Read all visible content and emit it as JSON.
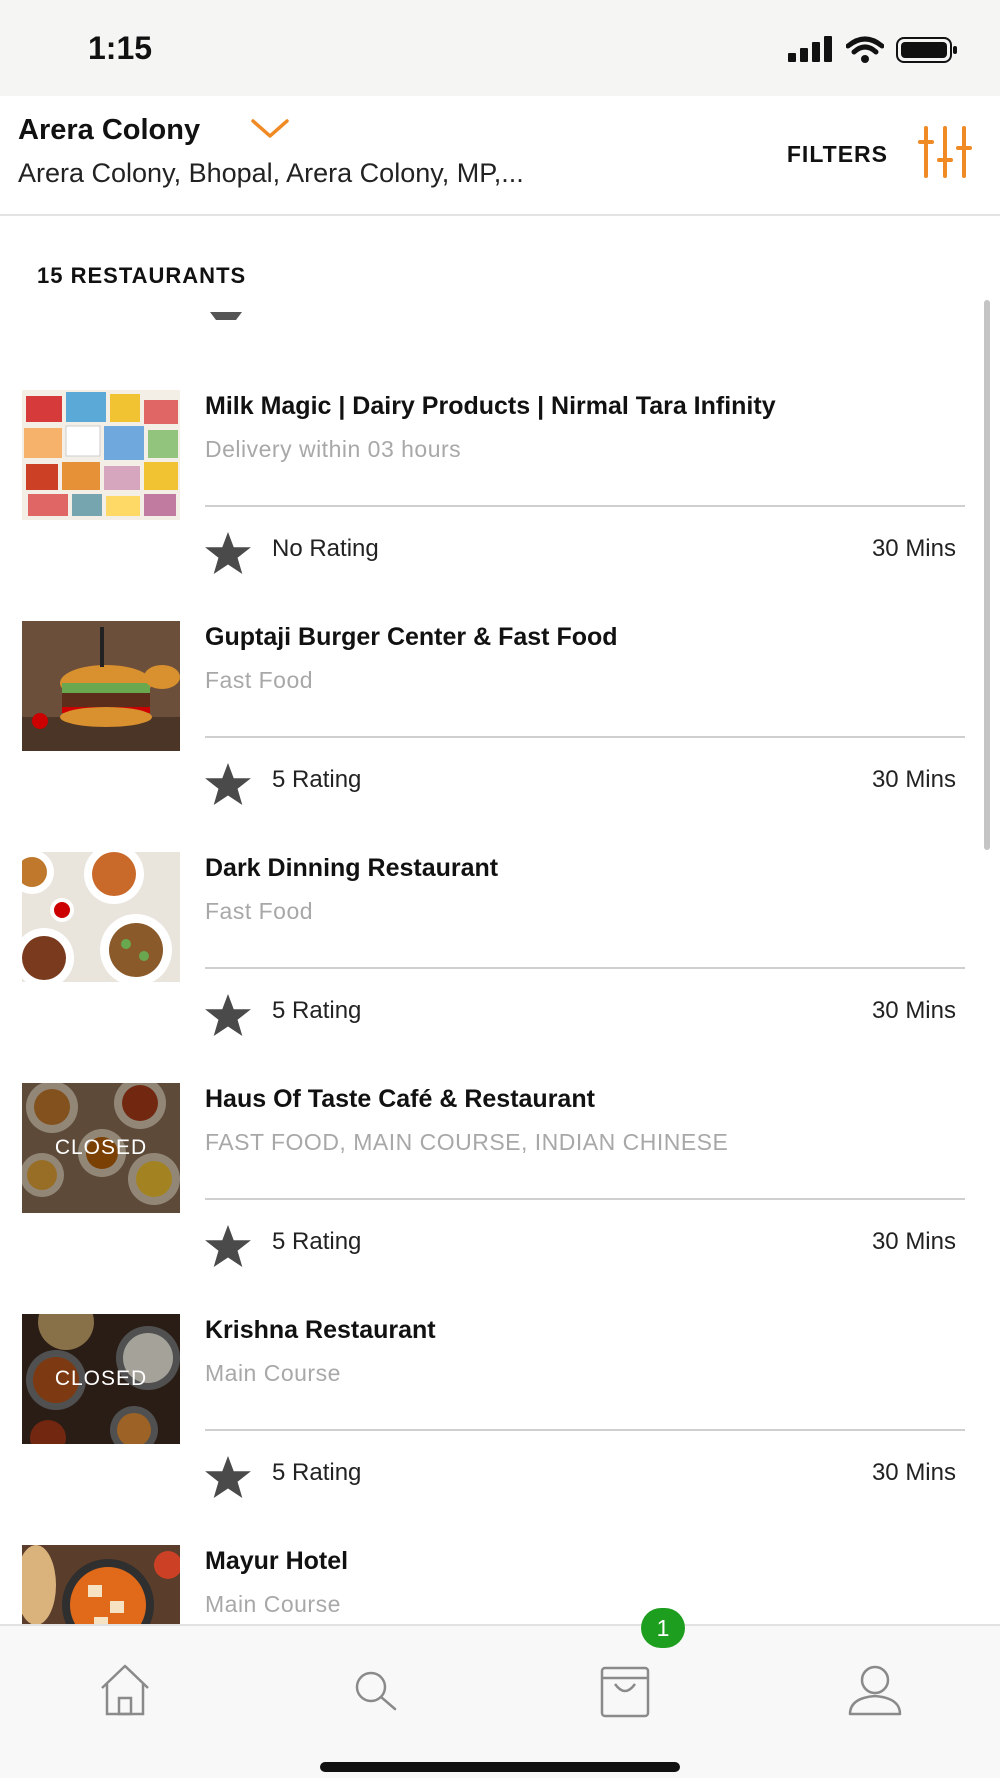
{
  "status_bar": {
    "time": "1:15",
    "icons": [
      "signal-icon",
      "wifi-icon",
      "battery-icon"
    ]
  },
  "header": {
    "location_title": "Arera Colony",
    "location_subtitle": "Arera Colony, Bhopal, Arera Colony, MP,...",
    "filters_label": "FILTERS",
    "accent_color": "#f08a24"
  },
  "restaurant_count": "15 RESTAURANTS",
  "restaurants": [
    {
      "name": "Milk Magic | Dairy Products | Nirmal Tara Infinity",
      "cuisine": "Delivery within 03 hours",
      "rating": "No Rating",
      "time": "30 Mins",
      "closed": false
    },
    {
      "name": "Guptaji Burger Center & Fast Food",
      "cuisine": "Fast Food",
      "rating": "5 Rating",
      "time": "30 Mins",
      "closed": false
    },
    {
      "name": "Dark Dinning Restaurant",
      "cuisine": "Fast Food",
      "rating": "5 Rating",
      "time": "30 Mins",
      "closed": false
    },
    {
      "name": "Haus Of Taste Café & Restaurant",
      "cuisine": "FAST FOOD, MAIN COURSE, INDIAN CHINESE",
      "rating": "5 Rating",
      "time": "30 Mins",
      "closed": true,
      "closed_label": "CLOSED"
    },
    {
      "name": "Krishna Restaurant",
      "cuisine": "Main Course",
      "rating": "5 Rating",
      "time": "30 Mins",
      "closed": true,
      "closed_label": "CLOSED"
    },
    {
      "name": "Mayur Hotel",
      "cuisine": "Main Course",
      "closed": false
    }
  ],
  "tab_bar": {
    "tabs": [
      "home-icon",
      "search-icon",
      "cart-icon",
      "profile-icon"
    ],
    "cart_badge": "1",
    "badge_color": "#1e9e1e"
  }
}
